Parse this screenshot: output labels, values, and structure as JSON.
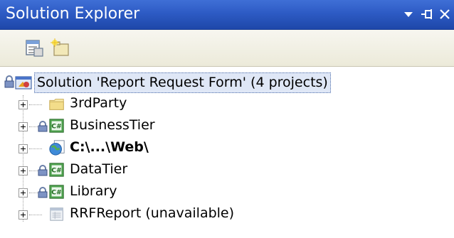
{
  "panel": {
    "title": "Solution Explorer",
    "buttons": [
      {
        "name": "dropdown",
        "glyph": "▾"
      },
      {
        "name": "pin",
        "glyph": "⊣"
      },
      {
        "name": "close",
        "glyph": "✕"
      }
    ]
  },
  "toolbar": {
    "items": [
      {
        "icon": "properties-icon"
      },
      {
        "icon": "show-all-files-icon"
      }
    ]
  },
  "tree": {
    "root": {
      "label": "Solution 'Report Request Form' (4 projects)",
      "icon": "solution-icon",
      "selected": true
    },
    "items": [
      {
        "label": "3rdParty",
        "icon": "folder-icon",
        "locked": false
      },
      {
        "label": "BusinessTier",
        "icon": "csharp-project-icon",
        "locked": true
      },
      {
        "label": "C:\\...\\Web\\",
        "icon": "website-icon",
        "locked": false,
        "bold": true
      },
      {
        "label": "DataTier",
        "icon": "csharp-project-icon",
        "locked": true
      },
      {
        "label": "Library",
        "icon": "csharp-project-icon",
        "locked": true
      },
      {
        "label": "RRFReport (unavailable)",
        "icon": "report-project-icon",
        "locked": false
      }
    ]
  },
  "colors": {
    "title_bar": "#2d5bc4",
    "selection": "#dfe7f6",
    "toolbar": "#ecead9"
  }
}
